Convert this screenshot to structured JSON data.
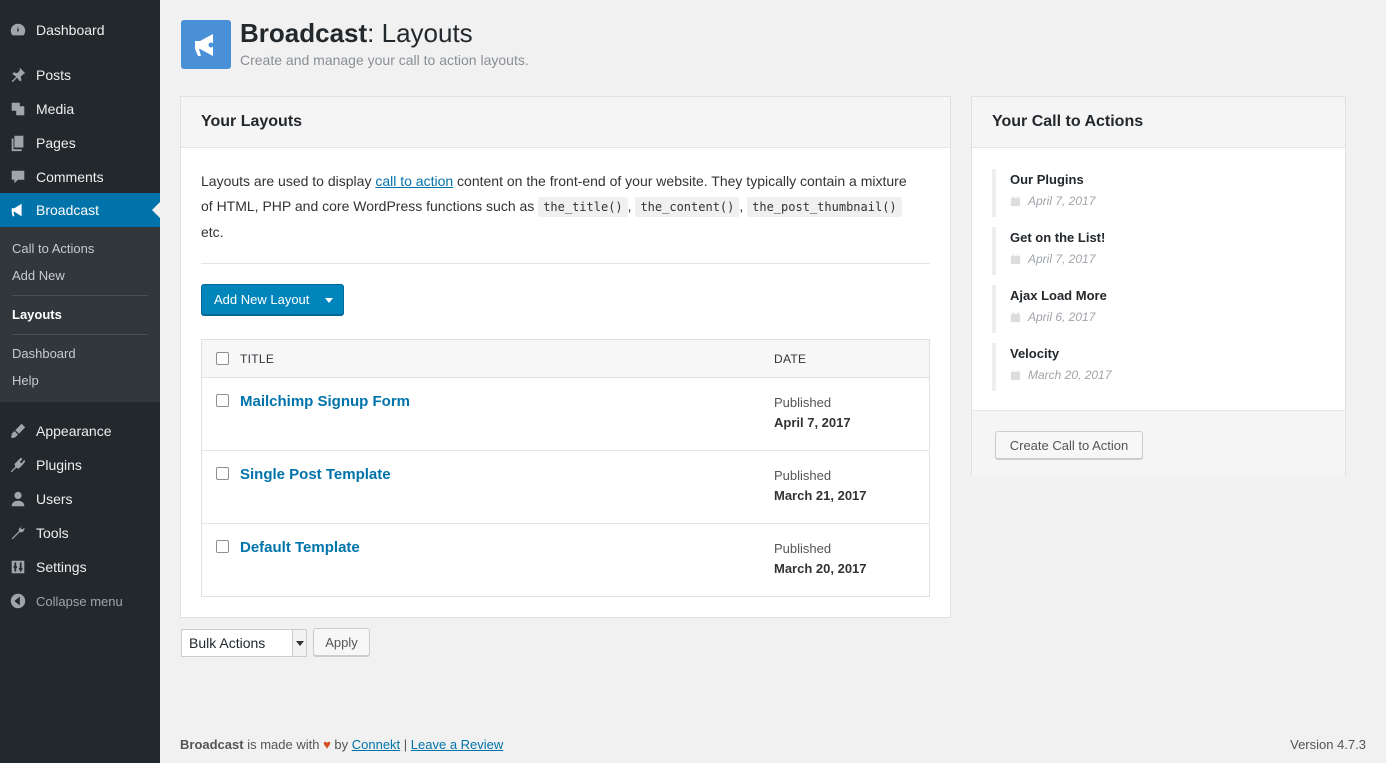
{
  "sidebar": {
    "menu": [
      {
        "label": "Dashboard",
        "icon": "dashboard-icon"
      },
      {
        "label": "Posts",
        "icon": "pin-icon"
      },
      {
        "label": "Media",
        "icon": "media-icon"
      },
      {
        "label": "Pages",
        "icon": "pages-icon"
      },
      {
        "label": "Comments",
        "icon": "comment-icon"
      },
      {
        "label": "Broadcast",
        "icon": "megaphone-icon"
      },
      {
        "label": "Appearance",
        "icon": "paintbrush-icon"
      },
      {
        "label": "Plugins",
        "icon": "plugin-icon"
      },
      {
        "label": "Users",
        "icon": "user-icon"
      },
      {
        "label": "Tools",
        "icon": "wrench-icon"
      },
      {
        "label": "Settings",
        "icon": "settings-icon"
      },
      {
        "label": "Collapse menu",
        "icon": "collapse-icon"
      }
    ],
    "submenu": [
      {
        "label": "Call to Actions"
      },
      {
        "label": "Add New"
      },
      {
        "label": "Layouts"
      },
      {
        "label": "Dashboard"
      },
      {
        "label": "Help"
      }
    ]
  },
  "header": {
    "title_bold": "Broadcast",
    "title_rest": ": Layouts",
    "subtitle": "Create and manage your call to action layouts."
  },
  "layouts_panel": {
    "title": "Your Layouts",
    "desc_1": "Layouts are used to display ",
    "desc_link": "call to action",
    "desc_2": " content on the front-end of your website. They typically contain a mixture of HTML, PHP and core WordPress functions such as ",
    "code_1": "the_title()",
    "sep_1": ", ",
    "code_2": "the_content()",
    "sep_2": ", ",
    "code_3": "the_post_thumbnail()",
    "desc_3": " etc.",
    "add_button": "Add New Layout",
    "table": {
      "col_title": "TITLE",
      "col_date": "DATE",
      "rows": [
        {
          "title": "Mailchimp Signup Form",
          "status": "Published",
          "date": "April 7, 2017"
        },
        {
          "title": "Single Post Template",
          "status": "Published",
          "date": "March 21, 2017"
        },
        {
          "title": "Default Template",
          "status": "Published",
          "date": "March 20, 2017"
        }
      ]
    }
  },
  "bulk": {
    "select": "Bulk Actions",
    "apply": "Apply"
  },
  "cta_panel": {
    "title": "Your Call to Actions",
    "items": [
      {
        "name": "Our Plugins",
        "date": "April 7, 2017"
      },
      {
        "name": "Get on the List!",
        "date": "April 7, 2017"
      },
      {
        "name": "Ajax Load More",
        "date": "April 6, 2017"
      },
      {
        "name": "Velocity",
        "date": "March 20, 2017"
      }
    ],
    "create_button": "Create Call to Action"
  },
  "footer": {
    "brand": "Broadcast",
    "made_with": " is made with ",
    "heart": "♥",
    "by": " by ",
    "link_1": "Connekt",
    "pipe": " | ",
    "link_2": "Leave a Review",
    "version": "Version 4.7.3"
  },
  "colors": {
    "sidebar_bg": "#23282d",
    "submenu_bg": "#32373c",
    "accent": "#0073aa",
    "button_primary": "#0085ba",
    "header_icon_bg": "#4a90d9"
  }
}
